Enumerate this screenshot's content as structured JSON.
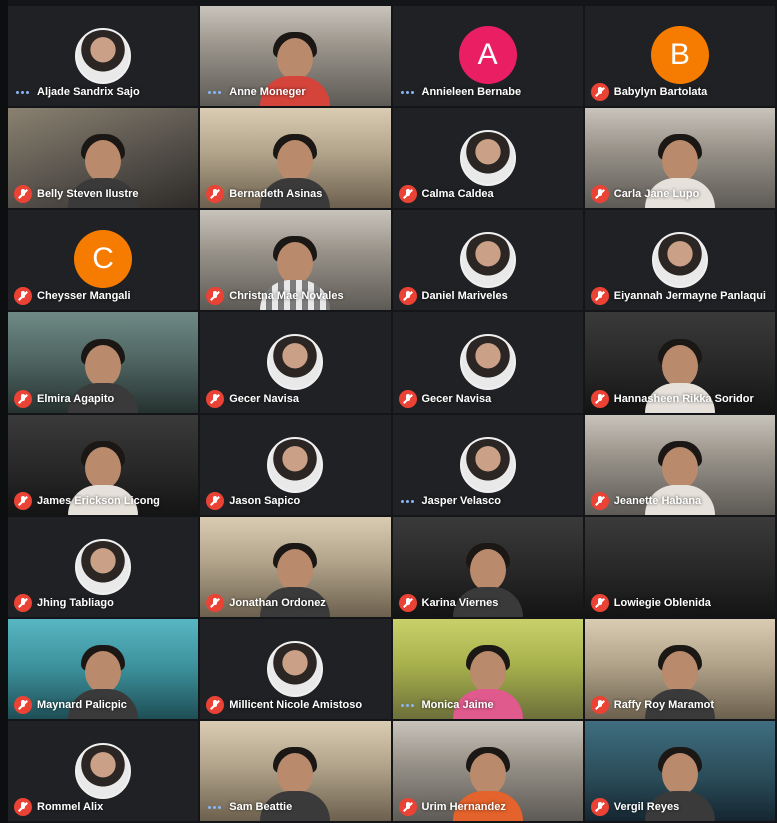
{
  "tiles": [
    {
      "name": "Aljade Sandrix Sajo",
      "kind": "photo",
      "status": "speaking"
    },
    {
      "name": "Anne Moneger",
      "kind": "video",
      "status": "speaking"
    },
    {
      "name": "Annieleen Bernabe",
      "kind": "letter",
      "letter": "A",
      "color": "#e91e63",
      "status": "speaking"
    },
    {
      "name": "Babylyn Bartolata",
      "kind": "letter",
      "letter": "B",
      "color": "#f57c00",
      "status": "muted"
    },
    {
      "name": "Belly Steven Ilustre",
      "kind": "video",
      "status": "muted"
    },
    {
      "name": "Bernadeth Asinas",
      "kind": "video",
      "status": "muted"
    },
    {
      "name": "Calma Caldea",
      "kind": "photo",
      "status": "muted"
    },
    {
      "name": "Carla Jane Lupo",
      "kind": "video",
      "status": "muted"
    },
    {
      "name": "Cheysser Mangali",
      "kind": "letter",
      "letter": "C",
      "color": "#f57c00",
      "status": "muted"
    },
    {
      "name": "Christna Mae Novales",
      "kind": "video",
      "status": "muted"
    },
    {
      "name": "Daniel Mariveles",
      "kind": "photo",
      "status": "muted"
    },
    {
      "name": "Eiyannah Jermayne Panlaqui",
      "kind": "photo",
      "status": "muted"
    },
    {
      "name": "Elmira Agapito",
      "kind": "video",
      "status": "muted"
    },
    {
      "name": "Gecer Navisa",
      "kind": "photo",
      "status": "muted"
    },
    {
      "name": "Gecer Navisa",
      "kind": "photo",
      "status": "muted"
    },
    {
      "name": "Hannasheen Rikka Soridor",
      "kind": "video",
      "status": "muted"
    },
    {
      "name": "James Erickson Licong",
      "kind": "video",
      "status": "muted"
    },
    {
      "name": "Jason Sapico",
      "kind": "photo",
      "status": "muted"
    },
    {
      "name": "Jasper Velasco",
      "kind": "photo",
      "status": "speaking"
    },
    {
      "name": "Jeanette Habana",
      "kind": "video",
      "status": "muted"
    },
    {
      "name": "Jhing Tabliago",
      "kind": "photo",
      "status": "muted"
    },
    {
      "name": "Jonathan Ordonez",
      "kind": "video",
      "status": "muted"
    },
    {
      "name": "Karina Viernes",
      "kind": "video",
      "status": "muted"
    },
    {
      "name": "Lowiegie Oblenida",
      "kind": "video",
      "status": "muted"
    },
    {
      "name": "Maynard Palicpic",
      "kind": "video",
      "status": "muted"
    },
    {
      "name": "Millicent Nicole Amistoso",
      "kind": "photo",
      "status": "muted"
    },
    {
      "name": "Monica Jaime",
      "kind": "video",
      "status": "speaking"
    },
    {
      "name": "Raffy Roy Maramot",
      "kind": "video",
      "status": "muted"
    },
    {
      "name": "Rommel Alix",
      "kind": "photo",
      "status": "muted"
    },
    {
      "name": "Sam Beattie",
      "kind": "video",
      "status": "speaking"
    },
    {
      "name": "Urim Hernandez",
      "kind": "video",
      "status": "muted"
    },
    {
      "name": "Vergil Reyes",
      "kind": "video",
      "status": "muted"
    }
  ]
}
